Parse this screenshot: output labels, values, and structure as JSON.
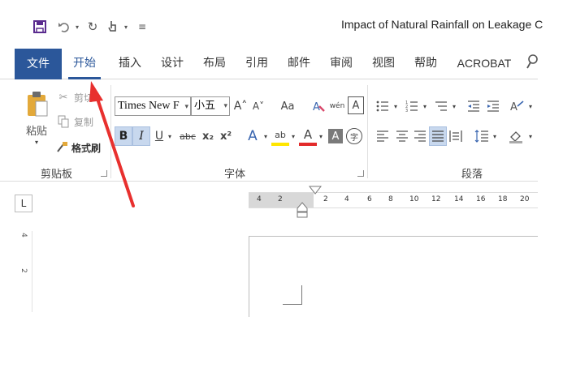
{
  "app": {
    "document_title": "Impact of Natural Rainfall on Leakage C",
    "accent_color": "#2b579a",
    "annotation_color": "#e8302e"
  },
  "quick_access": {
    "save_icon": "save-icon",
    "undo_glyph": "5",
    "redo_glyph": "↻",
    "touch_icon": "touch-mode-icon",
    "customize_glyph": "≡"
  },
  "tabs": [
    {
      "label": "文件"
    },
    {
      "label": "开始"
    },
    {
      "label": "插入"
    },
    {
      "label": "设计"
    },
    {
      "label": "布局"
    },
    {
      "label": "引用"
    },
    {
      "label": "邮件"
    },
    {
      "label": "审阅"
    },
    {
      "label": "视图"
    },
    {
      "label": "帮助"
    },
    {
      "label": "ACROBAT"
    }
  ],
  "clipboard": {
    "paste_label": "粘贴",
    "cut_label": "剪切",
    "copy_label": "复制",
    "format_painter_label": "格式刷",
    "group_label": "剪贴板"
  },
  "font": {
    "font_name": "Times New F",
    "font_size": "小五",
    "grow_glyph": "A˄",
    "shrink_glyph": "A˅",
    "case_glyph": "Aa",
    "phonetic_glyph": "wén",
    "border_glyph": "A",
    "bold_glyph": "B",
    "italic_glyph": "I",
    "underline_glyph": "U",
    "strike_glyph": "abc",
    "subscript_glyph": "x₂",
    "superscript_glyph": "x²",
    "effects_glyph": "A",
    "highlight_glyph": "ab",
    "color_glyph": "A",
    "shading_glyph": "A",
    "enclose_glyph": "字",
    "group_label": "字体"
  },
  "paragraph": {
    "group_label": "段落"
  },
  "ruler": {
    "tab_stop_glyph": "L",
    "ticks": [
      "4",
      "2",
      "2",
      "4",
      "6",
      "8",
      "10",
      "12",
      "14",
      "16",
      "18",
      "20"
    ],
    "vertical_ticks": [
      "4",
      "2"
    ]
  }
}
